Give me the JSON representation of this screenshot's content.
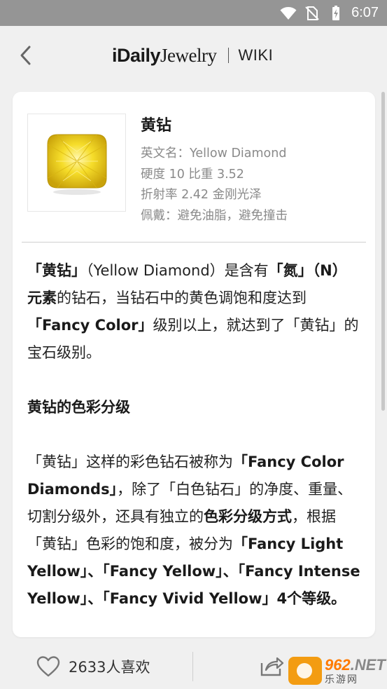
{
  "status_bar": {
    "time": "6:07",
    "icons": [
      "wifi-icon",
      "no-sim-icon",
      "battery-charging-icon"
    ]
  },
  "header": {
    "back_icon": "chevron-left-icon",
    "brand_part1": "iDaily",
    "brand_part2": "Jewelry",
    "section": "WIKI"
  },
  "gem": {
    "name": "黄钻",
    "meta": [
      "英文名：Yellow Diamond",
      "硬度 10 比重 3.52",
      "折射率 2.42 金刚光泽",
      "佩戴：避免油脂，避免撞击"
    ],
    "image_icon": "yellow-diamond-image"
  },
  "article": {
    "p1": {
      "s1": "「黄钻」",
      "s2": "（Yellow Diamond）是含有",
      "s3": "「氮」（N）元素",
      "s4": "的钻石，当钻石中的黄色调饱和度达到",
      "s5": "「Fancy Color」",
      "s6": "级别以上，就达到了「黄钻」的宝石级别。"
    },
    "heading": "黄钻的色彩分级",
    "p2": {
      "s1": "「黄钻」这样的彩色钻石被称为",
      "s2": "「Fancy Color Diamonds」",
      "s3": "，除了「白色钻石」的净度、重量、切割分级外，还具有独立的",
      "s4": "色彩分级方式",
      "s5": "，根据「黄钻」色彩的饱和度，被分为",
      "s6": "「Fancy Light Yellow」、「Fancy Yellow」、「Fancy Intense Yellow」、「Fancy Vivid Yellow」4个等级。"
    }
  },
  "footer": {
    "like_icon": "heart-outline-icon",
    "like_count": "2633",
    "like_label": "人喜欢",
    "share_icon": "share-icon"
  },
  "watermark": {
    "top_a": "962",
    "top_b": ".NET",
    "bottom": "乐游网"
  },
  "colors": {
    "status_bar": "#959595",
    "background": "#f0f0f0",
    "card": "#ffffff",
    "meta_text": "#8a8a8a",
    "gem_yellow": "#f2d31b"
  }
}
